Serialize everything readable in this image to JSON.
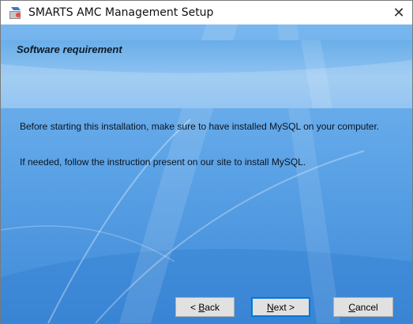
{
  "window": {
    "title": "SMARTS AMC Management Setup",
    "close_glyph": "✕"
  },
  "page": {
    "heading": "Software requirement",
    "message_1": "Before starting this installation, make sure to have installed MySQL on your computer.",
    "message_2": "If needed, follow the instruction present on our site to install MySQL."
  },
  "buttons": {
    "back": {
      "prefix": "< ",
      "mnemonic": "B",
      "rest": "ack"
    },
    "next": {
      "mnemonic": "N",
      "rest": "ext >"
    },
    "cancel": {
      "mnemonic": "C",
      "rest": "ancel"
    }
  },
  "colors": {
    "accent": "#0078d7",
    "background_blue": "#5da4e7"
  },
  "icons": {
    "app": "installer-icon",
    "close": "close-icon"
  }
}
